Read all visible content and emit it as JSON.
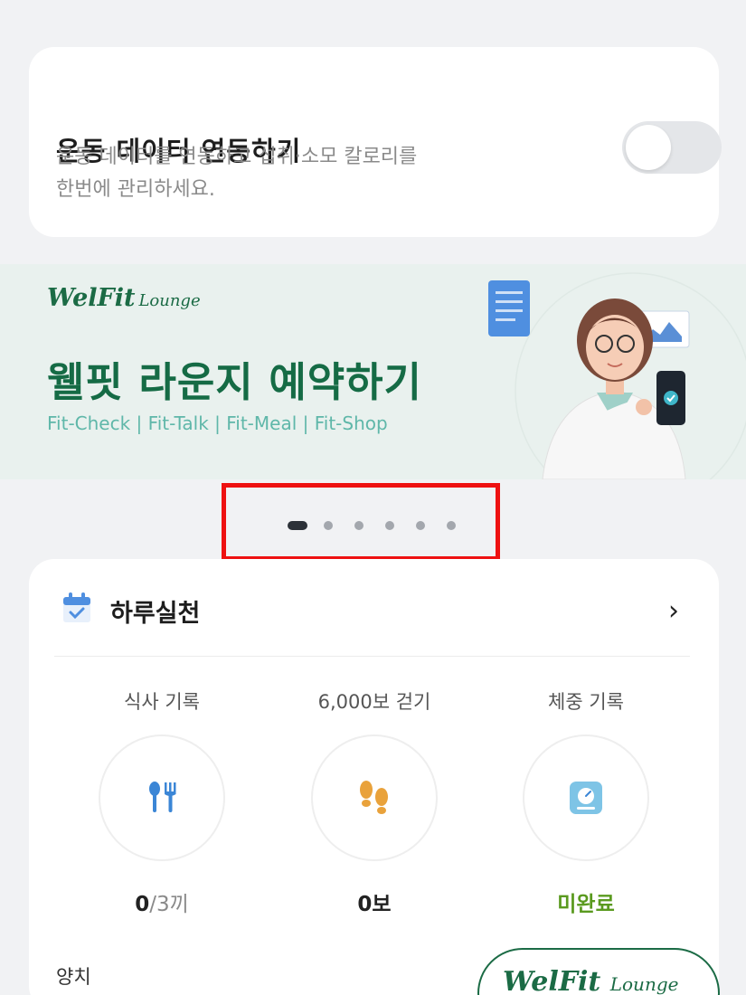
{
  "sync_card": {
    "title": "운동 데이터 연동하기",
    "description_line1": "운동 데이터를 연동하고 섭취·소모 칼로리를",
    "description_line2": "한번에 관리하세요.",
    "toggle_on": false
  },
  "banner": {
    "brand": "WelFit",
    "brand_suffix": "Lounge",
    "title": "웰핏 라운지 예약하기",
    "subtitle": "Fit-Check  |  Fit-Talk  |  Fit-Meal  |  Fit-Shop"
  },
  "carousel": {
    "total_pages": 6,
    "active_index": 0
  },
  "daily": {
    "title": "하루실천",
    "chevron": "›",
    "metrics": [
      {
        "label": "식사 기록",
        "icon": "fork-knife-icon",
        "value": "0",
        "unit": "/3끼"
      },
      {
        "label": "6,000보 걷기",
        "icon": "footprints-icon",
        "value": "0보",
        "unit": ""
      },
      {
        "label": "체중 기록",
        "icon": "scale-icon",
        "value": "미완료",
        "unit": ""
      }
    ],
    "bottom_label": "양치",
    "bottom_badge_brand": "WelFit",
    "bottom_badge_suffix": "Lounge"
  },
  "colors": {
    "brand_green": "#1b6b45",
    "highlight_red": "#ee1111",
    "status_green": "#5a9a1f",
    "banner_bg": "#e9f1ee"
  }
}
